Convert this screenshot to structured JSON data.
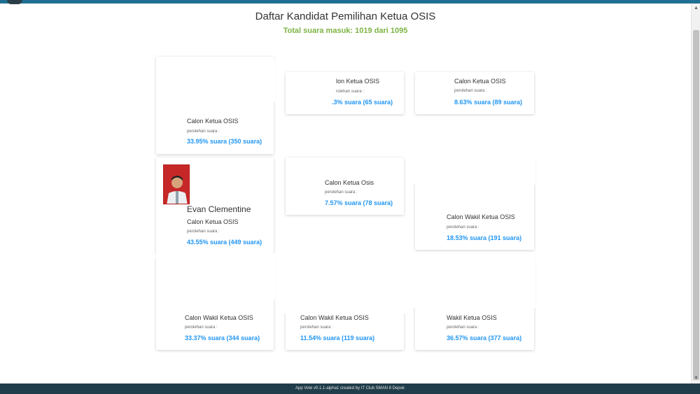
{
  "header": {
    "title": "Daftar Kandidat Pemilihan Ketua OSIS",
    "total_votes": "Total suara masuk: 1019 dari 1095"
  },
  "candidates": [
    {
      "role": "Calon Ketua OSIS",
      "votes_label": "perolehan suara :",
      "result": "33.95% suara (350 suara)",
      "share_percent": 33.95,
      "votes": 350
    },
    {
      "role": "lon Ketua OSIS",
      "votes_label": "rolehan suara :",
      "result": ".3% suara (65 suara)",
      "votes": 65
    },
    {
      "role": "Calon Ketua OSIS",
      "votes_label": "perolehan suara :",
      "result": "8.63% suara (89 suara)",
      "share_percent": 8.63,
      "votes": 89
    },
    {
      "name": "Evan Clementine",
      "role": "Calon Ketua OSIS",
      "votes_label": "perolehan suara :",
      "result": "43.55% suara (449 suara)",
      "share_percent": 43.55,
      "votes": 449
    },
    {
      "role": "Calon Ketua Osis",
      "votes_label": "perolehan suara :",
      "result": "7.57% suara (78 suara)",
      "share_percent": 7.57,
      "votes": 78
    },
    {
      "role": "Calon Wakil Ketua OSIS",
      "votes_label": "perolehan suara :",
      "result": "18.53% suara (191 suara)",
      "share_percent": 18.53,
      "votes": 191
    },
    {
      "role": "Calon Wakil Ketua OSIS",
      "votes_label": "perolehan suara :",
      "result": "33.37% suara (344 suara)",
      "share_percent": 33.37,
      "votes": 344
    },
    {
      "role": "Calon Wakil Ketua OSIS",
      "votes_label": "perolehan suara :",
      "result": "11.54% suara (119 suara)",
      "share_percent": 11.54,
      "votes": 119
    },
    {
      "role": "Wakil Ketua OSIS",
      "votes_label": "perolehan suara :",
      "result": "36.57% suara (377 suara)",
      "share_percent": 36.57,
      "votes": 377
    }
  ],
  "footer": {
    "text": "App Vote v0.1.1-alpha1 created by IT Club SMAN 8 Depok"
  },
  "colors": {
    "topbar": "#1e6f93",
    "total_votes": "#7cb342",
    "result": "#2196f3",
    "footer": "#1f3d4a"
  }
}
